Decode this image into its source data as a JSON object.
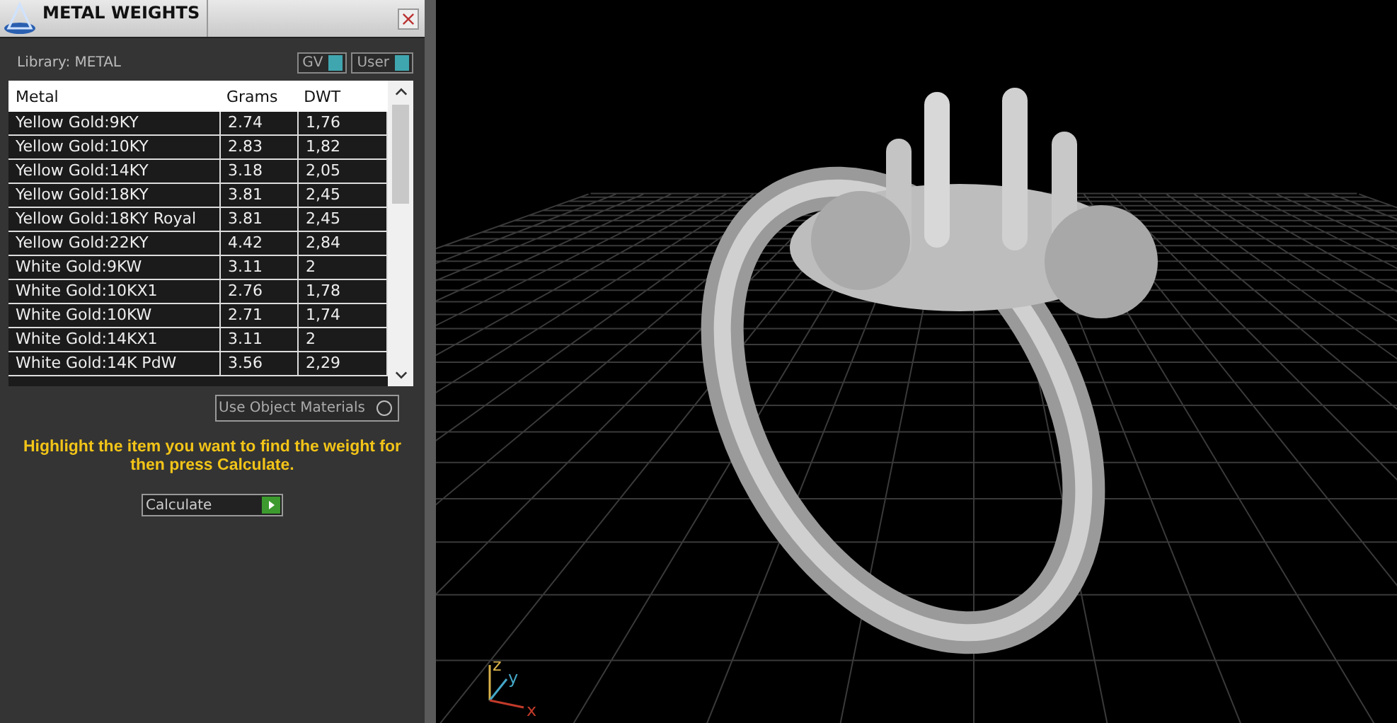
{
  "window": {
    "title": "METAL WEIGHTS"
  },
  "library": {
    "label": "Library: METAL"
  },
  "toggles": [
    {
      "label": "GV",
      "on": true
    },
    {
      "label": "User",
      "on": true
    }
  ],
  "table": {
    "columns": [
      "Metal",
      "Grams",
      "DWT"
    ],
    "rows": [
      [
        "Yellow Gold:9KY",
        "2.74",
        "1,76"
      ],
      [
        "Yellow Gold:10KY",
        "2.83",
        "1,82"
      ],
      [
        "Yellow Gold:14KY",
        "3.18",
        "2,05"
      ],
      [
        "Yellow Gold:18KY",
        "3.81",
        "2,45"
      ],
      [
        "Yellow Gold:18KY Royal",
        "3.81",
        "2,45"
      ],
      [
        "Yellow Gold:22KY",
        "4.42",
        "2,84"
      ],
      [
        "White Gold:9KW",
        "3.11",
        "2"
      ],
      [
        "White Gold:10KX1",
        "2.76",
        "1,78"
      ],
      [
        "White Gold:10KW",
        "2.71",
        "1,74"
      ],
      [
        "White Gold:14KX1",
        "3.11",
        "2"
      ],
      [
        "White Gold:14K PdW",
        "3.56",
        "2,29"
      ]
    ]
  },
  "use_object_materials": {
    "label": "Use Object Materials",
    "on": false
  },
  "instructions": "Highlight the item you want to find the weight for then press Calculate.",
  "calculate_button": "Calculate",
  "axes": {
    "z": "z",
    "y": "y",
    "x": "x"
  }
}
